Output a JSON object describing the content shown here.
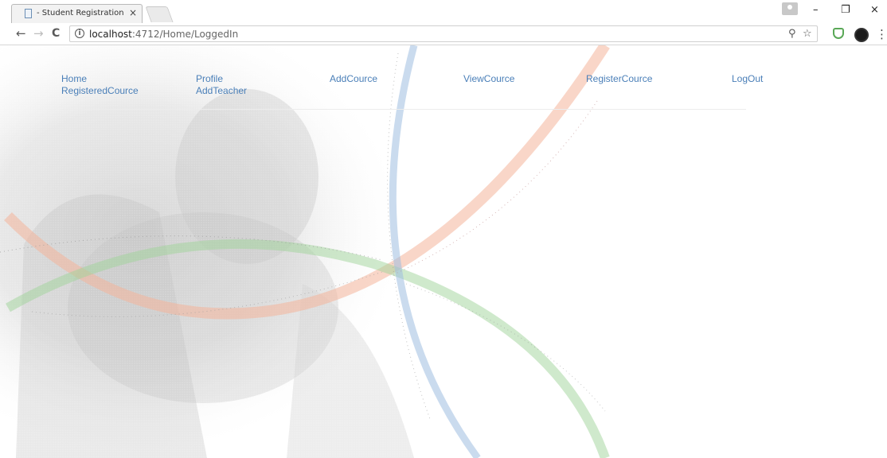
{
  "browser": {
    "tab_title": "- Student Registration Sy",
    "tab_close": "×",
    "url_host": "localhost",
    "url_path": ":4712/Home/LoggedIn",
    "info_icon": "i",
    "controls": {
      "minimize": "–",
      "restore": "❐",
      "close": "×"
    },
    "nav": {
      "back": "←",
      "forward": "→",
      "reload": "C"
    },
    "omnibox_icons": {
      "zoom": "⚲",
      "star": "☆",
      "menu": "⋮"
    }
  },
  "nav": {
    "links": [
      {
        "label": "Home"
      },
      {
        "label": "Profile"
      },
      {
        "label": "AddCource"
      },
      {
        "label": "ViewCource"
      },
      {
        "label": "RegisterCource"
      },
      {
        "label": "LogOut"
      },
      {
        "label": "RegisteredCource"
      },
      {
        "label": "AddTeacher"
      }
    ]
  },
  "colors": {
    "link": "#4a7fb8",
    "arc_orange": "#f4b49a",
    "arc_green": "#9fd49a",
    "arc_blue": "#9fbde0"
  }
}
